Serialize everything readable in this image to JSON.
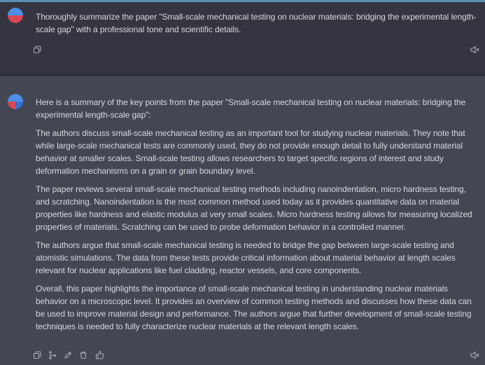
{
  "user_message": {
    "text": "Thoroughly summarize the paper \"Small-scale mechanical testing on nuclear materials: bridging the experimental length-scale gap\" with a professional tone and scientific details."
  },
  "assistant_message": {
    "paragraphs": [
      "Here is a summary of the key points from the paper \"Small-scale mechanical testing on nuclear materials: bridging the experimental length-scale gap\":",
      "The authors discuss small-scale mechanical testing as an important tool for studying nuclear materials. They note that while large-scale mechanical tests are commonly used, they do not provide enough detail to fully understand material behavior at smaller scales. Small-scale testing allows researchers to target specific regions of interest and study deformation mechanisms on a grain or grain boundary level.",
      "The paper reviews several small-scale mechanical testing methods including nanoindentation, micro hardness testing, and scratching. Nanoindentation is the most common method used today as it provides quantitative data on material properties like hardness and elastic modulus at very small scales. Micro hardness testing allows for measuring localized properties of materials. Scratching can be used to probe deformation behavior in a controlled manner.",
      "The authors argue that small-scale mechanical testing is needed to bridge the gap between large-scale testing and atomistic simulations. The data from these tests provide critical information about material behavior at length scales relevant for nuclear applications like fuel cladding, reactor vessels, and core components.",
      "Overall, this paper highlights the importance of small-scale mechanical testing in understanding nuclear materials behavior on a microscopic level. It provides an overview of common testing methods and discusses how these data can be used to improve material design and performance. The authors argue that further development of small-scale testing techniques is needed to fully characterize nuclear materials at the relevant length scales."
    ]
  },
  "icons": {
    "user_avatar": "user-avatar-icon",
    "bot_avatar": "assistant-avatar-icon",
    "copy": "copy-icon",
    "speaker": "speaker-icon",
    "branch": "branch-icon",
    "edit": "pencil-icon",
    "delete": "trash-icon",
    "like": "thumbs-up-icon"
  },
  "colors": {
    "background_user": "#343541",
    "background_assistant": "#444654",
    "text": "#d7d8dc",
    "icon": "#a9aab3"
  }
}
